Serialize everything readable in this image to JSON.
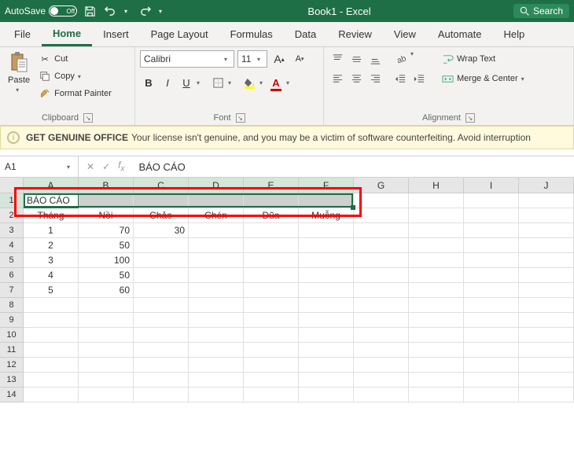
{
  "title_bar": {
    "autosave_label": "AutoSave",
    "autosave_state": "Off",
    "doc_title": "Book1  -  Excel",
    "search_label": "Search"
  },
  "tabs": [
    "File",
    "Home",
    "Insert",
    "Page Layout",
    "Formulas",
    "Data",
    "Review",
    "View",
    "Automate",
    "Help"
  ],
  "active_tab_index": 1,
  "ribbon": {
    "clipboard": {
      "paste": "Paste",
      "cut": "Cut",
      "copy": "Copy",
      "format_painter": "Format Painter",
      "group": "Clipboard"
    },
    "font": {
      "name": "Calibri",
      "size": "11",
      "group": "Font"
    },
    "alignment": {
      "wrap": "Wrap Text",
      "merge": "Merge & Center",
      "group": "Alignment"
    }
  },
  "warning": {
    "title": "GET GENUINE OFFICE",
    "text": "Your license isn't genuine, and you may be a victim of software counterfeiting. Avoid interruption"
  },
  "name_box": "A1",
  "formula_value": "BÁO CÁO",
  "columns": [
    "A",
    "B",
    "C",
    "D",
    "E",
    "F",
    "G",
    "H",
    "I",
    "J"
  ],
  "selected_cols": [
    0,
    1,
    2,
    3,
    4,
    5
  ],
  "rows_count": 14,
  "cells": {
    "A1": "BÁO CÁO",
    "A2": "Tháng",
    "B2": "Nồi",
    "C2": "Chảo",
    "D2": "Chén",
    "E2": "Đũa",
    "F2": "Muỗng",
    "A3": "1",
    "B3": "70",
    "C3": "30",
    "A4": "2",
    "B4": "50",
    "A5": "3",
    "B5": "100",
    "A6": "4",
    "B6": "50",
    "A7": "5",
    "B7": "60"
  },
  "chart_data": {
    "type": "table",
    "title": "BÁO CÁO",
    "headers": [
      "Tháng",
      "Nồi",
      "Chảo",
      "Chén",
      "Đũa",
      "Muỗng"
    ],
    "rows": [
      [
        1,
        70,
        30,
        null,
        null,
        null
      ],
      [
        2,
        50,
        null,
        null,
        null,
        null
      ],
      [
        3,
        100,
        null,
        null,
        null,
        null
      ],
      [
        4,
        50,
        null,
        null,
        null,
        null
      ],
      [
        5,
        60,
        null,
        null,
        null,
        null
      ]
    ]
  }
}
